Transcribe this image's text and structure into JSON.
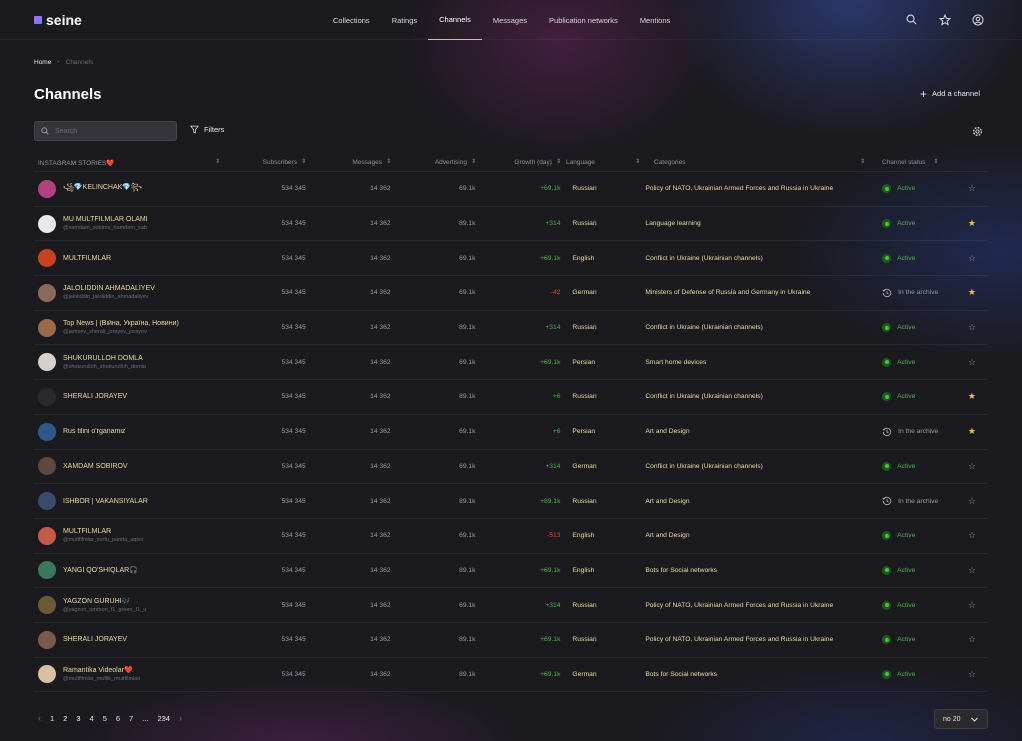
{
  "logo": "seine",
  "nav": [
    "Collections",
    "Ratings",
    "Channels",
    "Messages",
    "Publication networks",
    "Mentions"
  ],
  "nav_active": "Channels",
  "breadcrumb": {
    "home": "Home",
    "current": "Channels"
  },
  "page_title": "Channels",
  "add_channel": "Add a channel",
  "search_placeholder": "Search",
  "filters": "Filters",
  "columns": {
    "name": "INSTAGRAM STORIES❤️",
    "subscribers": "Subscribers",
    "messages": "Messages",
    "advertising": "Advertising",
    "growth": "Growth (day)",
    "language": "Language",
    "categories": "Categories",
    "status": "Channel status"
  },
  "rows": [
    {
      "name": "꧁💎KELINCHAK💎꧂",
      "handle": "",
      "subs": "534 345",
      "msgs": "14 362",
      "adv": "69.1k",
      "growth": "+69.1k",
      "growth_sign": "pos",
      "lang": "Russian",
      "cat": "Policy of NATO, Ukrainian Armed Forces and Russia in Ukraine",
      "status": "Active",
      "starred": false,
      "avatar_color": "#b3427a"
    },
    {
      "name": "MU MULTFILMLAR OLAMI",
      "handle": "@xamdam_sobirov_hamdam_sab",
      "subs": "534 345",
      "msgs": "14 362",
      "adv": "89.1k",
      "growth": "+314",
      "growth_sign": "pos",
      "lang": "Russian",
      "cat": "Language learning",
      "status": "Active",
      "starred": true,
      "avatar_color": "#e8e8e8"
    },
    {
      "name": "MULTFILMLAR",
      "handle": "",
      "subs": "534 345",
      "msgs": "14 362",
      "adv": "69.1k",
      "growth": "+69.1k",
      "growth_sign": "pos",
      "lang": "English",
      "cat": "Conflict in Ukraine (Ukrainian channels)",
      "status": "Active",
      "starred": false,
      "avatar_color": "#c9421f"
    },
    {
      "name": "JALOLIDDIN AHMADALIYEV",
      "handle": "@jaloliddin_jaloliddin_ahmadaliyev",
      "subs": "534 345",
      "msgs": "14 362",
      "adv": "69.1k",
      "growth": "-42",
      "growth_sign": "neg",
      "lang": "German",
      "cat": "Ministers of Defense of Russia and Germany in Ukraine",
      "status": "In the archive",
      "starred": true,
      "avatar_color": "#8a6a5a"
    },
    {
      "name": "Top News | (Війна, Україна, Новини)",
      "handle": "@jamsev_sherali_jorayev_jorayev",
      "subs": "534 345",
      "msgs": "14 362",
      "adv": "89.1k",
      "growth": "+314",
      "growth_sign": "pos",
      "lang": "Russian",
      "cat": "Conflict in Ukraine (Ukrainian channels)",
      "status": "Active",
      "starred": false,
      "avatar_color": "#9a6a4a"
    },
    {
      "name": "SHUKURULLOH DOMLA",
      "handle": "@shukurulloh_shukurulloh_domla",
      "subs": "534 345",
      "msgs": "14 362",
      "adv": "69.1k",
      "growth": "+69.1k",
      "growth_sign": "pos",
      "lang": "Persian",
      "cat": "Smart home devices",
      "status": "Active",
      "starred": false,
      "avatar_color": "#d8d0c8"
    },
    {
      "name": "SHERALI JORAYEV",
      "handle": "",
      "subs": "534 345",
      "msgs": "14 362",
      "adv": "89.1k",
      "growth": "+6",
      "growth_sign": "pos",
      "lang": "Russian",
      "cat": "Conflict in Ukraine (Ukrainian channels)",
      "status": "Active",
      "starred": true,
      "avatar_color": "#2a2a2a"
    },
    {
      "name": "Rus tilini o'rganamiz",
      "handle": "",
      "subs": "534 345",
      "msgs": "14 362",
      "adv": "69.1k",
      "growth": "+6",
      "growth_sign": "pos",
      "lang": "Persian",
      "cat": "Art and Design",
      "status": "In the archive",
      "starred": true,
      "avatar_color": "#2d5a8a"
    },
    {
      "name": "XAMDAM SOBIROV",
      "handle": "",
      "subs": "534 345",
      "msgs": "14 362",
      "adv": "69.1k",
      "growth": "+314",
      "growth_sign": "pos",
      "lang": "German",
      "cat": "Conflict in Ukraine (Ukrainian channels)",
      "status": "Active",
      "starred": false,
      "avatar_color": "#5a4a40"
    },
    {
      "name": "ISHBOR | VAKANSIYALAR",
      "handle": "",
      "subs": "534 345",
      "msgs": "14 362",
      "adv": "89.1k",
      "growth": "+89.1k",
      "growth_sign": "pos",
      "lang": "Russian",
      "cat": "Art and Design",
      "status": "In the archive",
      "starred": false,
      "avatar_color": "#3a4a6a"
    },
    {
      "name": "MULTFILMLAR",
      "handle": "@multfilmlar_xurfu_panda_aqlvo",
      "subs": "534 345",
      "msgs": "14 362",
      "adv": "69.1k",
      "growth": "-513",
      "growth_sign": "neg",
      "lang": "English",
      "cat": "Art and Design",
      "status": "Active",
      "starred": false,
      "avatar_color": "#c85a4a"
    },
    {
      "name": "YANGI QO'SHIQLAR🎧",
      "handle": "",
      "subs": "534 345",
      "msgs": "14 362",
      "adv": "89.1k",
      "growth": "+69.1k",
      "growth_sign": "pos",
      "lang": "English",
      "cat": "Bots for Social networks",
      "status": "Active",
      "starred": false,
      "avatar_color": "#3a7a5a"
    },
    {
      "name": "YAGZON GURUHI🎶",
      "handle": "@yagzon_ummon_f1_green_f1_u",
      "subs": "534 345",
      "msgs": "14 362",
      "adv": "69.1k",
      "growth": "+314",
      "growth_sign": "pos",
      "lang": "Russian",
      "cat": "Policy of NATO, Ukrainian Armed Forces and Russia in Ukraine",
      "status": "Active",
      "starred": false,
      "avatar_color": "#6a5a3a"
    },
    {
      "name": "SHERALI JORAYEV",
      "handle": "",
      "subs": "534 345",
      "msgs": "14 362",
      "adv": "89.1k",
      "growth": "+69.1k",
      "growth_sign": "pos",
      "lang": "Russian",
      "cat": "Policy of NATO, Ukrainian Armed Forces and Russia in Ukraine",
      "status": "Active",
      "starred": false,
      "avatar_color": "#7a5a4a"
    },
    {
      "name": "Ramantika Videolar❤️",
      "handle": "@multfilmlar_multik_multfilmlari",
      "subs": "534 345",
      "msgs": "14 362",
      "adv": "89.1k",
      "growth": "+69.1k",
      "growth_sign": "pos",
      "lang": "German",
      "cat": "Bots for Social networks",
      "status": "Active",
      "starred": false,
      "avatar_color": "#d8c0a0"
    }
  ],
  "pagination": {
    "pages": [
      "1",
      "2",
      "3",
      "4",
      "5",
      "6",
      "7",
      "...",
      "234"
    ],
    "per_page": "no 20"
  }
}
